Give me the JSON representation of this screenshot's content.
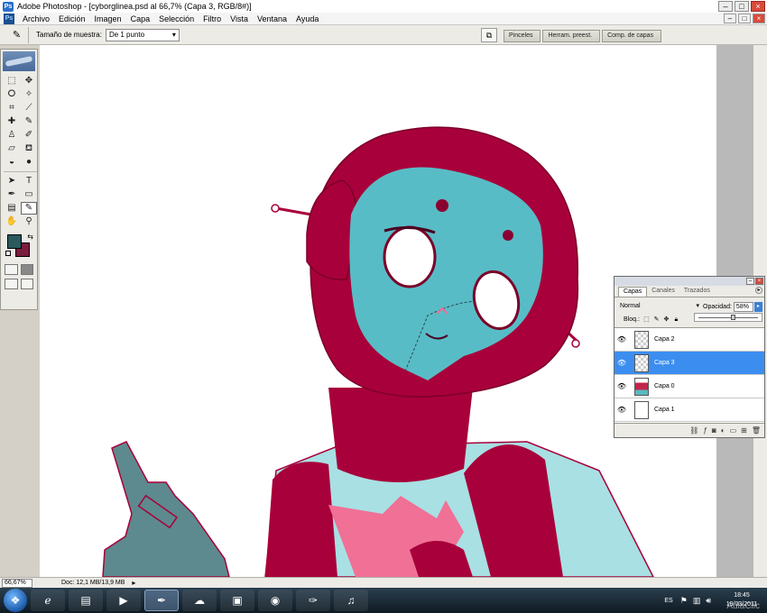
{
  "window": {
    "title": "Adobe Photoshop - [cyborglinea.psd al 66,7% (Capa 3, RGB/8#)]",
    "app_icon": "Ps",
    "min_glyph": "–",
    "max_glyph": "□",
    "close_glyph": "×"
  },
  "menu": {
    "logo": "Ps",
    "items": [
      "Archivo",
      "Edición",
      "Imagen",
      "Capa",
      "Selección",
      "Filtro",
      "Vista",
      "Ventana",
      "Ayuda"
    ]
  },
  "options": {
    "tool_glyph": "✎",
    "sample_label": "Tamaño de muestra:",
    "sample_value": "De 1 punto",
    "palette_tabs": [
      "Pinceles",
      "Herram. preest.",
      "Comp. de capas"
    ]
  },
  "colors": {
    "foreground": "#2a5a5e",
    "background": "#7b1d3e",
    "accent": "#3b8ef0"
  },
  "status": {
    "zoom": "66,67%",
    "doc_info": "Doc: 12,1 MB/13,9 MB",
    "arrow_glyph": "▸"
  },
  "layers_panel": {
    "tabs": [
      "Capas",
      "Canales",
      "Trazados"
    ],
    "blend_mode": "Normal",
    "opacity_label": "Opacidad:",
    "opacity_value": "58%",
    "opacity_fraction": 0.58,
    "lock_label": "Bloq.:",
    "layers": [
      {
        "name": "Capa 2",
        "visible": true,
        "selected": false,
        "thumb": "checker"
      },
      {
        "name": "Capa 3",
        "visible": true,
        "selected": true,
        "thumb": "checker"
      },
      {
        "name": "Capa 0",
        "visible": true,
        "selected": false,
        "thumb": "art"
      },
      {
        "name": "Capa 1",
        "visible": true,
        "selected": false,
        "thumb": "white"
      }
    ]
  },
  "taskbar": {
    "language": "ES",
    "time": "18:45",
    "date": "19/03/2011",
    "watermark": "AulaClic",
    "apps": [
      "internet-explorer",
      "folder",
      "media-player",
      "photoshop-cs",
      "network",
      "screenshot",
      "chrome",
      "pen-tool",
      "itunes"
    ]
  }
}
